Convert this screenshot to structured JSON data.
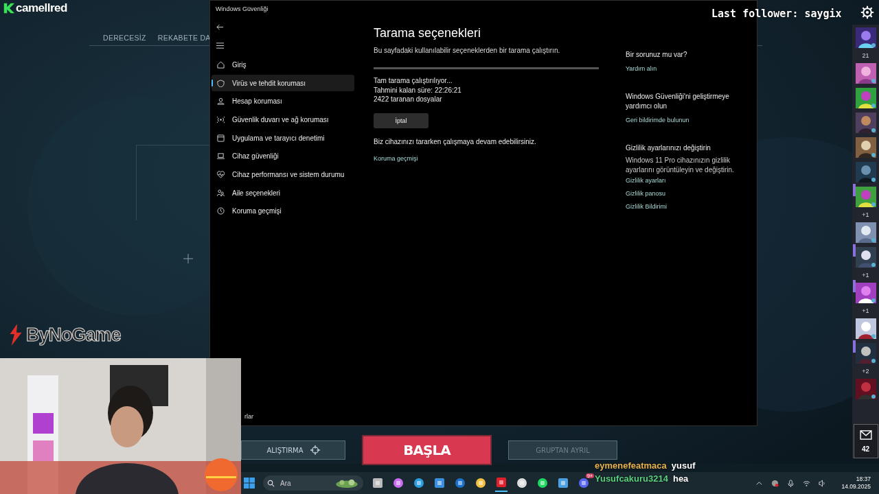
{
  "overlay": {
    "brand": "camellred",
    "last_follower": "Last follower: saygix",
    "sponsor": "ByNoGame"
  },
  "game": {
    "tabs": [
      {
        "label": "DERECESİZ"
      },
      {
        "label": "REKABETE DA"
      }
    ],
    "buttons": [
      {
        "label": "ALIŞTIRMA",
        "kind": "secondary"
      },
      {
        "label": "BAŞLA",
        "kind": "primary"
      },
      {
        "label": "GRUPTAN AYRIL",
        "kind": "disabled"
      }
    ],
    "friends": [
      {
        "kind": "picture",
        "party": false
      },
      {
        "kind": "count",
        "text": "21"
      },
      {
        "kind": "picture",
        "party": false
      },
      {
        "kind": "picture",
        "party": false
      },
      {
        "kind": "picture",
        "party": false
      },
      {
        "kind": "picture",
        "party": false
      },
      {
        "kind": "picture",
        "party": false
      },
      {
        "kind": "picture",
        "party": true
      },
      {
        "kind": "count",
        "text": "+1"
      },
      {
        "kind": "picture",
        "party": false
      },
      {
        "kind": "picture",
        "party": true
      },
      {
        "kind": "count",
        "text": "+1"
      },
      {
        "kind": "picture",
        "party": true
      },
      {
        "kind": "count",
        "text": "+1"
      },
      {
        "kind": "picture",
        "party": false
      },
      {
        "kind": "picture",
        "party": true
      },
      {
        "kind": "count",
        "text": "+2"
      },
      {
        "kind": "picture",
        "party": false
      }
    ],
    "mail_count": "42"
  },
  "window": {
    "title": "Windows Güvenliği",
    "nav": [
      {
        "label": "Giriş",
        "selected": false
      },
      {
        "label": "Virüs ve tehdit koruması",
        "selected": true
      },
      {
        "label": "Hesap koruması",
        "selected": false
      },
      {
        "label": "Güvenlik duvarı ve ağ koruması",
        "selected": false
      },
      {
        "label": "Uygulama ve tarayıcı denetimi",
        "selected": false
      },
      {
        "label": "Cihaz güvenliği",
        "selected": false
      },
      {
        "label": "Cihaz performansı ve sistem durumu",
        "selected": false
      },
      {
        "label": "Aile seçenekleri",
        "selected": false
      },
      {
        "label": "Koruma geçmişi",
        "selected": false
      }
    ],
    "footer_item": "rlar",
    "page": {
      "title": "Tarama seçenekleri",
      "subtitle": "Bu sayfadaki kullanılabilir seçeneklerden bir tarama çalıştırın.",
      "status": [
        "Tam tarama çalıştırılıyor...",
        "Tahmini kalan süre: 22:26:21",
        "2422  taranan dosyalar"
      ],
      "cancel_button": "İptal",
      "note": "Biz cihazınızı tararken çalışmaya devam edebilirsiniz.",
      "link": "Koruma geçmişi"
    },
    "aside": [
      {
        "heading": "Bir sorunuz mu var?",
        "links": [
          "Yardım alın"
        ]
      },
      {
        "heading": "Windows Güvenliği'ni geliştirmeye yardımcı olun",
        "links": [
          "Geri bildirimde bulunun"
        ]
      },
      {
        "heading": "Gizlilik ayarlarınızı değiştirin",
        "body": "Windows 11 Pro cihazınızın gizlilik ayarlarını görüntüleyin ve değiştirin.",
        "links": [
          "Gizlilik ayarları",
          "Gizlilik panosu",
          "Gizlilik Bildirimi"
        ]
      }
    ]
  },
  "chat": [
    {
      "user": "eymenefeatmaca",
      "message": "yusuf",
      "color": "#e8b450"
    },
    {
      "user": "Yusufcakuru3214",
      "message": "hea",
      "color": "#5ad17e"
    }
  ],
  "taskbar": {
    "search_placeholder": "Ara",
    "badge": "9+",
    "time": "18:37",
    "date": "14.09.2025"
  }
}
